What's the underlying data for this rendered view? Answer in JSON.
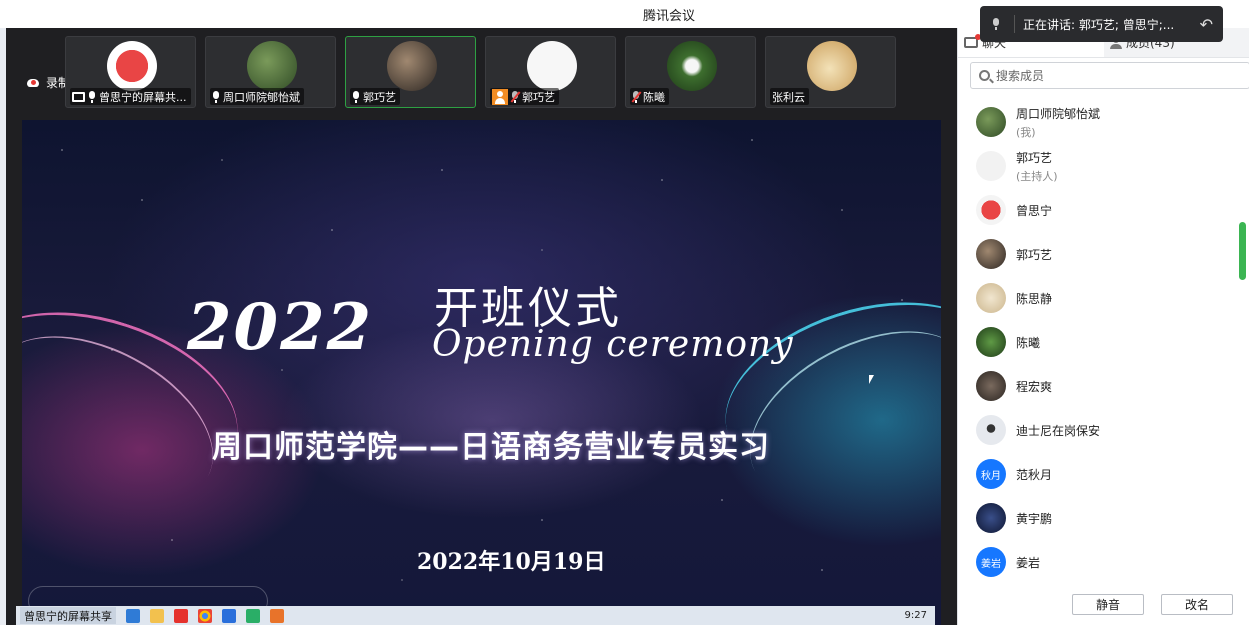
{
  "window": {
    "title": "腾讯会议"
  },
  "recording": {
    "label": "录制中"
  },
  "speaking_toast": {
    "text": "正在讲话: 郭巧艺; 曾思宁;...",
    "back_icon": "reply-icon"
  },
  "video_tiles": [
    {
      "name": "曾思宁的屏幕共...",
      "active": false,
      "avatar_color": "#e94545",
      "mic_muted": false,
      "sharing": true
    },
    {
      "name": "周口师院郇怡斌",
      "active": false,
      "avatar_color": "#4a6b3a",
      "mic_muted": false,
      "sharing": false
    },
    {
      "name": "郭巧艺",
      "active": true,
      "avatar_color": "#6b5a4a",
      "mic_muted": false,
      "sharing": false
    },
    {
      "name": "郭巧艺",
      "active": false,
      "avatar_color": "#f4f4f4",
      "mic_muted": true,
      "sharing": false
    },
    {
      "name": "陈曦",
      "active": false,
      "avatar_color": "#3d6e2e",
      "mic_muted": true,
      "sharing": false
    },
    {
      "name": "张利云",
      "active": false,
      "avatar_color": "#e2c08a",
      "mic_muted": false,
      "sharing": false
    }
  ],
  "slide": {
    "year": "2022",
    "title_cn": "开班仪式",
    "title_en": "Opening ceremony",
    "subtitle": "周口师范学院——日语商务营业专员实习",
    "date": "2022年10月19日"
  },
  "taskbar": {
    "share_label": "曾思宁的屏幕共享",
    "clock": "9:27"
  },
  "panel": {
    "tab_chat": "聊天",
    "tab_members": "成员(43)",
    "search_placeholder": "搜索成员",
    "members": [
      {
        "name": "周口师院郇怡斌",
        "role": "(我)",
        "avatar_color": "#4a6b3a",
        "avatar_text": ""
      },
      {
        "name": "郭巧艺",
        "role": "(主持人)",
        "avatar_color": "#f2f2f2",
        "avatar_text": ""
      },
      {
        "name": "曾思宁",
        "role": "",
        "avatar_color": "#e94545",
        "avatar_text": ""
      },
      {
        "name": "郭巧艺",
        "role": "",
        "avatar_color": "#6b5a4a",
        "avatar_text": ""
      },
      {
        "name": "陈思静",
        "role": "",
        "avatar_color": "#d9c9a8",
        "avatar_text": ""
      },
      {
        "name": "陈曦",
        "role": "",
        "avatar_color": "#2f5e25",
        "avatar_text": ""
      },
      {
        "name": "程宏爽",
        "role": "",
        "avatar_color": "#3a3430",
        "avatar_text": ""
      },
      {
        "name": "迪士尼在岗保安",
        "role": "",
        "avatar_color": "#dfe3e8",
        "avatar_text": ""
      },
      {
        "name": "范秋月",
        "role": "",
        "avatar_color": "#1677ff",
        "avatar_text": "秋月"
      },
      {
        "name": "黄宇鹏",
        "role": "",
        "avatar_color": "#1b2a55",
        "avatar_text": ""
      },
      {
        "name": "姜岩",
        "role": "",
        "avatar_color": "#1677ff",
        "avatar_text": "姜岩"
      }
    ],
    "btn_mute": "静音",
    "btn_rename": "改名"
  }
}
